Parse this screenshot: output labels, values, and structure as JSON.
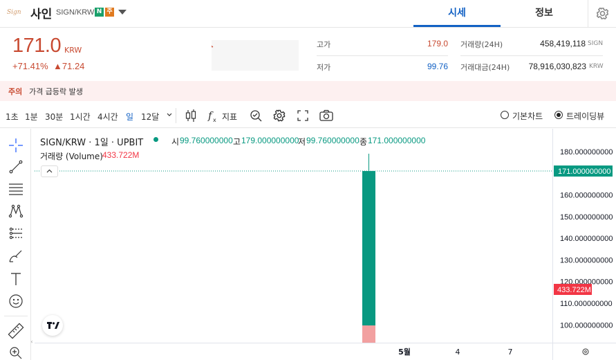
{
  "header": {
    "logo": "Sign",
    "coin_name": "사인",
    "pair": "SIGN/KRW",
    "badge_n": "N",
    "badge_warn": "주",
    "tabs": [
      {
        "label": "시세",
        "active": true
      },
      {
        "label": "정보",
        "active": false
      }
    ]
  },
  "price": {
    "value": "171.0",
    "unit": "KRW",
    "change_rate": "+71.41%",
    "change_abs": "▲71.24",
    "up_color": "#c84a31"
  },
  "stats": {
    "high_label": "고가",
    "high_value": "179.0",
    "low_label": "저가",
    "low_value": "99.76",
    "volume_label": "거래량(24H)",
    "volume_value": "458,419,118",
    "volume_unit": "SIGN",
    "amount_label": "거래대금(24H)",
    "amount_value": "78,916,030,823",
    "amount_unit": "KRW"
  },
  "warning": {
    "tag": "주의",
    "message": "가격 급등락 발생"
  },
  "toolbar": {
    "timeframes": [
      {
        "label": "1초",
        "selected": false
      },
      {
        "label": "1분",
        "selected": false
      },
      {
        "label": "30분",
        "selected": false
      },
      {
        "label": "1시간",
        "selected": false
      },
      {
        "label": "4시간",
        "selected": false
      },
      {
        "label": "일",
        "selected": true
      },
      {
        "label": "12달",
        "selected": false
      }
    ],
    "indicator_label": "지표",
    "chart_modes": [
      {
        "label": "기본차트",
        "selected": false
      },
      {
        "label": "트레이딩뷰",
        "selected": true
      }
    ]
  },
  "chart": {
    "title": "SIGN/KRW · 1일 · UPBIT",
    "open_label": "시",
    "open": "99.760000000",
    "high_label": "고",
    "high": "179.000000000",
    "low_label": "저",
    "low": "99.760000000",
    "close_label": "종",
    "close": "171.000000000",
    "volume_label": "거래량 (Volume)",
    "volume_value": "433.722M",
    "up_color": "#089981",
    "volume_color": "#f2a0a0",
    "volume_tag_color": "#f23645"
  },
  "chart_data": {
    "type": "candlestick",
    "x_ticks": [
      "5월",
      "4",
      "7"
    ],
    "y_ticks": [
      "100.000000000",
      "110.000000000",
      "120.000000000",
      "130.000000000",
      "140.000000000",
      "150.000000000",
      "160.000000000",
      "170.000000000",
      "180.000000000"
    ],
    "ylim": [
      91.8,
      190.5
    ],
    "last_price_label": "171.000000000",
    "candles": [
      {
        "open": 99.76,
        "high": 179.0,
        "low": 99.76,
        "close": 171.0
      }
    ],
    "volume": [
      {
        "value_label": "433.722M",
        "value": 433722000
      }
    ]
  }
}
